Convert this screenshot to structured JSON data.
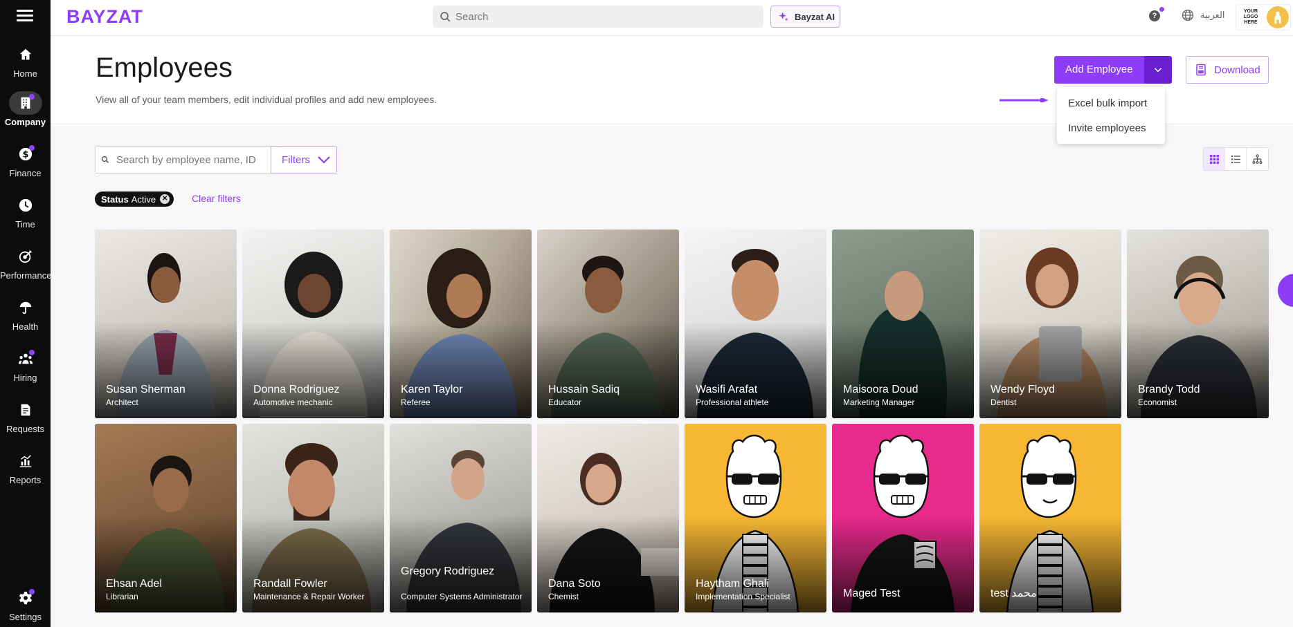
{
  "app": {
    "logo": "BAYZAT"
  },
  "sidebar": {
    "items": [
      {
        "label": "Home",
        "icon": "home-icon",
        "active": false,
        "dot": false
      },
      {
        "label": "Company",
        "icon": "building-icon",
        "active": true,
        "dot": true
      },
      {
        "label": "Finance",
        "icon": "dollar-icon",
        "active": false,
        "dot": true
      },
      {
        "label": "Time",
        "icon": "clock-icon",
        "active": false,
        "dot": false
      },
      {
        "label": "Performance",
        "icon": "target-icon",
        "active": false,
        "dot": false
      },
      {
        "label": "Health",
        "icon": "umbrella-icon",
        "active": false,
        "dot": false
      },
      {
        "label": "Hiring",
        "icon": "people-icon",
        "active": false,
        "dot": true
      },
      {
        "label": "Requests",
        "icon": "document-icon",
        "active": false,
        "dot": false
      },
      {
        "label": "Reports",
        "icon": "chart-icon",
        "active": false,
        "dot": false
      }
    ],
    "settings_label": "Settings"
  },
  "topbar": {
    "search_placeholder": "Search",
    "ai_label": "Bayzat AI",
    "help_label": "?",
    "language_label": "العربية",
    "company_logo_text": "YOUR LOGO HERE"
  },
  "header": {
    "title": "Employees",
    "subtitle": "View all of your team members, edit individual profiles and add new employees.",
    "add_label": "Add Employee",
    "download_label": "Download"
  },
  "dropdown": {
    "options": [
      "Excel bulk import",
      "Invite employees"
    ]
  },
  "filters": {
    "search_placeholder": "Search by employee name, ID",
    "filters_label": "Filters",
    "chip_key": "Status",
    "chip_value": "Active",
    "clear_label": "Clear filters"
  },
  "colors": {
    "accent": "#8E3CF7",
    "accent_dark": "#6A1FD0",
    "sidebar": "#0C0C0C"
  },
  "employees": [
    {
      "name": "Susan Sherman",
      "role": "Architect"
    },
    {
      "name": "Donna Rodriguez",
      "role": "Automotive mechanic"
    },
    {
      "name": "Karen Taylor",
      "role": "Referee"
    },
    {
      "name": "Hussain Sadiq",
      "role": "Educator"
    },
    {
      "name": "Wasifi Arafat",
      "role": "Professional athlete"
    },
    {
      "name": "Maisoora Doud",
      "role": "Marketing Manager"
    },
    {
      "name": "Wendy Floyd",
      "role": "Dentist"
    },
    {
      "name": "Brandy Todd",
      "role": "Economist"
    },
    {
      "name": "Ehsan Adel",
      "role": "Librarian"
    },
    {
      "name": "Randall Fowler",
      "role": "Maintenance & Repair Worker"
    },
    {
      "name": "Gregory Rodriguez",
      "role": "Computer Systems Administrator"
    },
    {
      "name": "Dana Soto",
      "role": "Chemist"
    },
    {
      "name": "Haytham Ghali",
      "role": "Implementation Specialist"
    },
    {
      "name": "Maged Test",
      "role": ""
    },
    {
      "name": "test محمد",
      "role": ""
    }
  ]
}
